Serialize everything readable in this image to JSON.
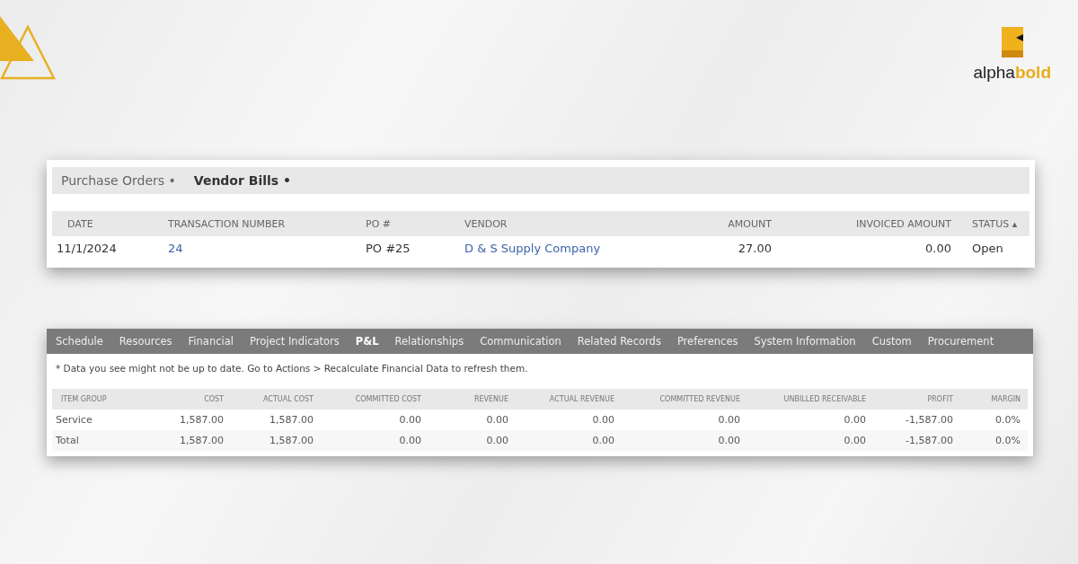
{
  "logo": {
    "part_1": "alpha",
    "part_2": "bold"
  },
  "transactions": {
    "tabs": [
      {
        "label": "Purchase Orders •",
        "selected": false
      },
      {
        "label": "Vendor Bills •",
        "selected": true
      }
    ],
    "columns": [
      "DATE",
      "TRANSACTION NUMBER",
      "PO #",
      "VENDOR",
      "AMOUNT",
      "INVOICED AMOUNT",
      "STATUS ▴"
    ],
    "rows": [
      {
        "cells": [
          {
            "text": "11/1/2024",
            "kind": "text"
          },
          {
            "text": "24",
            "kind": "link"
          },
          {
            "text": "PO #25",
            "kind": "text"
          },
          {
            "text": "D & S Supply Company",
            "kind": "link"
          },
          {
            "text": "27.00",
            "kind": "text"
          },
          {
            "text": "0.00",
            "kind": "text"
          },
          {
            "text": "Open",
            "kind": "text"
          }
        ]
      }
    ]
  },
  "project": {
    "tabs": [
      {
        "label": "Schedule",
        "selected": false
      },
      {
        "label": "Resources",
        "selected": false
      },
      {
        "label": "Financial",
        "selected": false
      },
      {
        "label": "Project Indicators",
        "selected": false
      },
      {
        "label": "P&L",
        "selected": true
      },
      {
        "label": "Relationships",
        "selected": false
      },
      {
        "label": "Communication",
        "selected": false
      },
      {
        "label": "Related Records",
        "selected": false
      },
      {
        "label": "Preferences",
        "selected": false
      },
      {
        "label": "System Information",
        "selected": false
      },
      {
        "label": "Custom",
        "selected": false
      },
      {
        "label": "Procurement",
        "selected": false
      }
    ],
    "note": "* Data you see might not be up to date. Go to Actions > Recalculate Financial Data to refresh them.",
    "columns": [
      "ITEM GROUP",
      "COST",
      "ACTUAL COST",
      "COMMITTED COST",
      "REVENUE",
      "ACTUAL REVENUE",
      "COMMITTED REVENUE",
      "UNBILLED RECEIVABLE",
      "PROFIT",
      "MARGIN"
    ],
    "rows": [
      [
        "Service",
        "1,587.00",
        "1,587.00",
        "0.00",
        "0.00",
        "0.00",
        "0.00",
        "0.00",
        "-1,587.00",
        "0.0%"
      ],
      [
        "Total",
        "1,587.00",
        "1,587.00",
        "0.00",
        "0.00",
        "0.00",
        "0.00",
        "0.00",
        "-1,587.00",
        "0.0%"
      ]
    ]
  }
}
